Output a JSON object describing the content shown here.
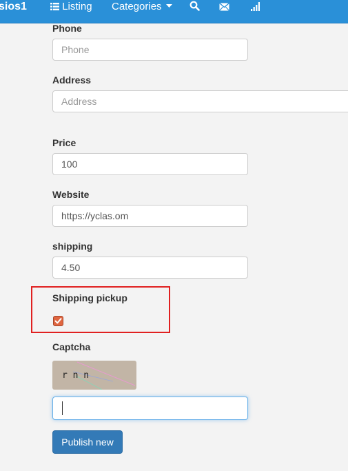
{
  "navbar": {
    "brand": "sios1",
    "listing": "Listing",
    "categories": "Categories"
  },
  "form": {
    "phone": {
      "label": "Phone",
      "placeholder": "Phone",
      "value": ""
    },
    "address": {
      "label": "Address",
      "placeholder": "Address",
      "value": ""
    },
    "price": {
      "label": "Price",
      "value": "100"
    },
    "website": {
      "label": "Website",
      "value": "https://yclas.om"
    },
    "shipping": {
      "label": "shipping",
      "value": "4.50"
    },
    "shipping_pickup": {
      "label": "Shipping pickup",
      "checked": true
    },
    "captcha": {
      "label": "Captcha",
      "code": "r n n",
      "value": ""
    },
    "submit_label": "Publish new"
  },
  "colors": {
    "navbar": "#2a90d8",
    "button": "#337ab7",
    "checkbox": "#e06640",
    "highlight": "#e02020"
  }
}
